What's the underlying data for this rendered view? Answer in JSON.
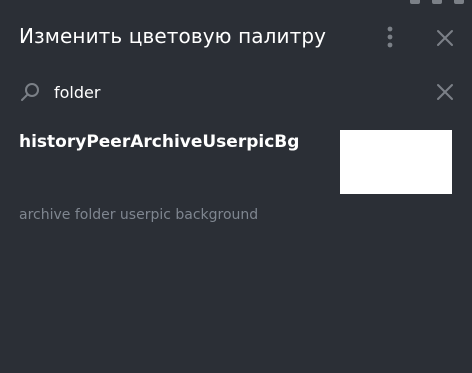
{
  "header": {
    "title": "Изменить цветовую палитру",
    "menu_icon": "more-vertical-icon",
    "close_icon": "close-icon"
  },
  "search": {
    "value": "folder",
    "icon": "search-icon",
    "clear_icon": "clear-icon"
  },
  "results": [
    {
      "name": "historyPeerArchiveUserpicBg",
      "description": "archive folder userpic background",
      "color": "#ffffff"
    }
  ],
  "colors": {
    "background": "#2b2f36",
    "text": "#ffffff",
    "muted_text": "#7f8690",
    "icon": "#7b8087"
  }
}
